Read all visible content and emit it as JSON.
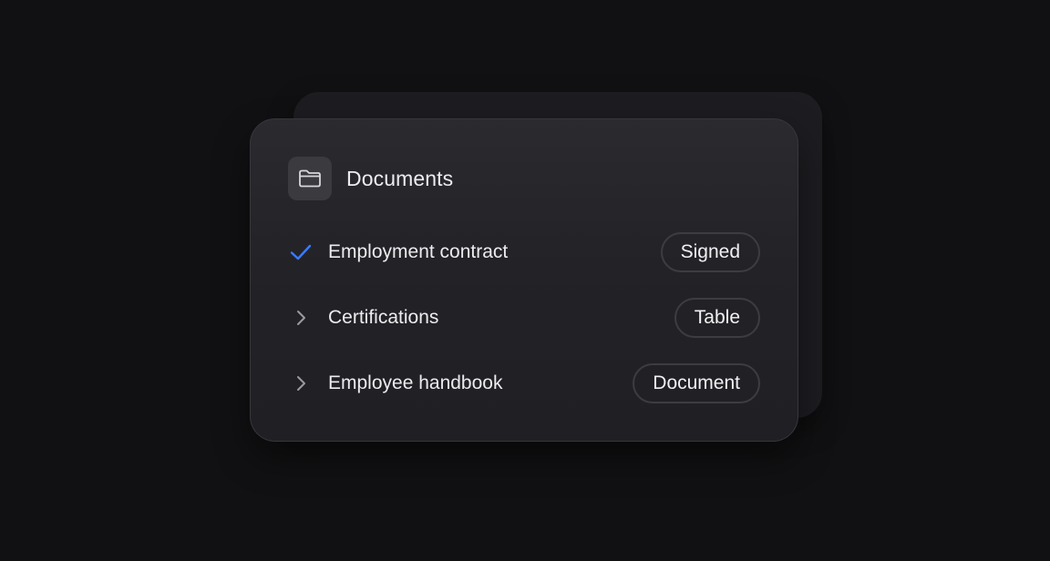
{
  "card": {
    "title": "Documents",
    "title_icon": "folder-icon"
  },
  "rows": [
    {
      "label": "Employment contract",
      "badge": "Signed",
      "icon": "check-icon",
      "icon_color": "#3b7bff"
    },
    {
      "label": "Certifications",
      "badge": "Table",
      "icon": "chevron-right-icon",
      "icon_color": "#9a9aa0"
    },
    {
      "label": "Employee handbook",
      "badge": "Document",
      "icon": "chevron-right-icon",
      "icon_color": "#9a9aa0"
    }
  ],
  "colors": {
    "background": "#111113",
    "card": "#232327",
    "accent": "#3b7bff"
  }
}
